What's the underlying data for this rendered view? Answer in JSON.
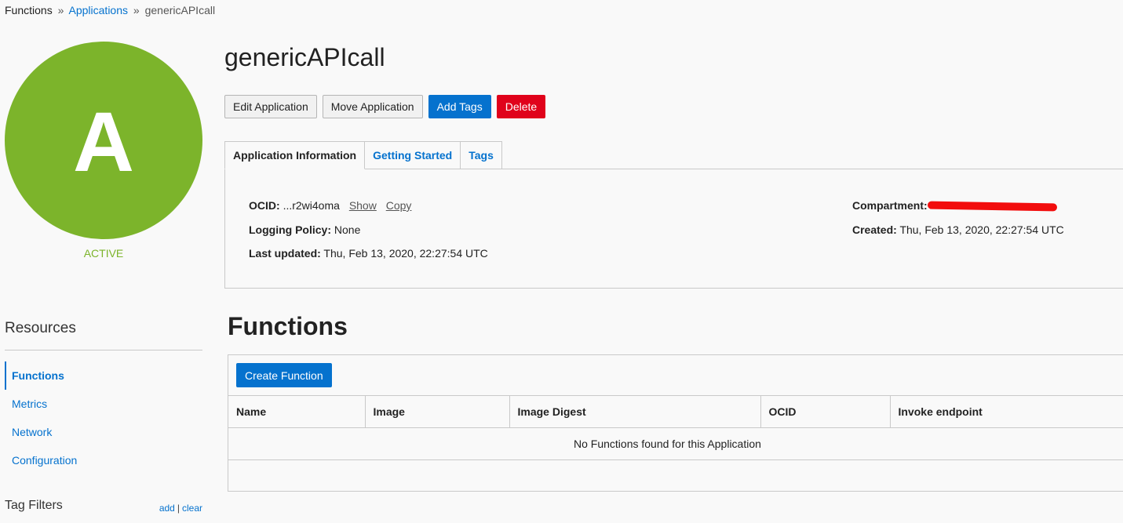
{
  "breadcrumb": {
    "root": "Functions",
    "separator": "»",
    "parent": "Applications",
    "current": "genericAPIcall"
  },
  "application": {
    "avatar_letter": "A",
    "state": "ACTIVE",
    "name": "genericAPIcall",
    "avatar_color": "#7cb42b"
  },
  "actions": {
    "edit": "Edit Application",
    "move": "Move Application",
    "add_tags": "Add Tags",
    "delete": "Delete"
  },
  "tabs": [
    {
      "label": "Application Information",
      "active": true
    },
    {
      "label": "Getting Started",
      "active": false
    },
    {
      "label": "Tags",
      "active": false
    }
  ],
  "info": {
    "ocid_label": "OCID:",
    "ocid_value": "...r2wi4oma",
    "show_label": "Show",
    "copy_label": "Copy",
    "logging_label": "Logging Policy:",
    "logging_value": "None",
    "updated_label": "Last updated:",
    "updated_value": "Thu, Feb 13, 2020, 22:27:54 UTC",
    "compartment_label": "Compartment:",
    "created_label": "Created:",
    "created_value": "Thu, Feb 13, 2020, 22:27:54 UTC"
  },
  "resources": {
    "title": "Resources",
    "items": [
      {
        "label": "Functions",
        "active": true
      },
      {
        "label": "Metrics",
        "active": false
      },
      {
        "label": "Network",
        "active": false
      },
      {
        "label": "Configuration",
        "active": false
      }
    ]
  },
  "tag_filters": {
    "title": "Tag Filters",
    "add": "add",
    "divider": "|",
    "clear": "clear"
  },
  "functions": {
    "title": "Functions",
    "create_label": "Create Function",
    "columns": [
      "Name",
      "Image",
      "Image Digest",
      "OCID",
      "Invoke endpoint"
    ],
    "empty_message": "No Functions found for this Application"
  },
  "colors": {
    "accent": "#0572ce",
    "danger": "#e0021b",
    "active_green": "#7cb42b"
  }
}
